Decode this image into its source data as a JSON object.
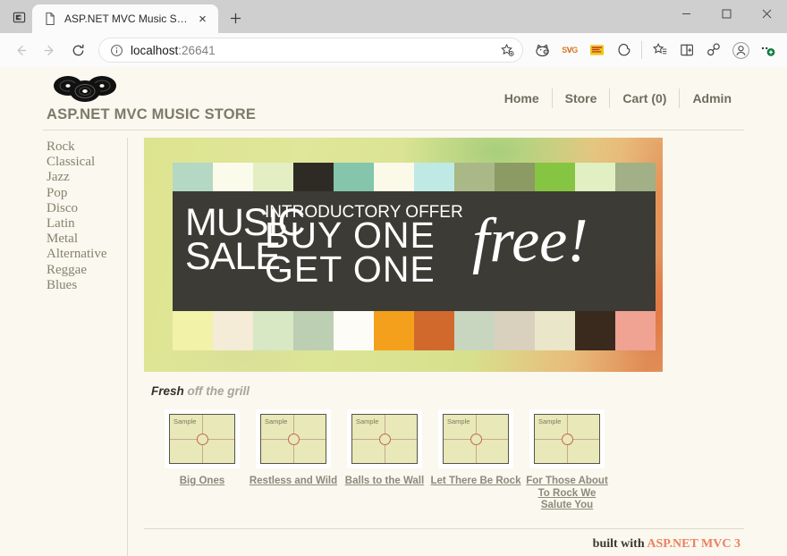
{
  "browser": {
    "tab": {
      "title": "ASP.NET MVC Music Store",
      "favicon": "page-icon",
      "close": "×"
    },
    "new_tab_label": "+",
    "tab_search_icon": "tab-search-icon",
    "window_controls": {
      "minimize": "−",
      "maximize": "□",
      "close": "✕"
    },
    "nav": {
      "back": "←",
      "forward": "→",
      "reload": "↻"
    },
    "omnibox": {
      "info_icon": "site-info-icon",
      "url_host": "localhost",
      "url_port": ":26641",
      "favorite_icon": "add-favorite-icon"
    },
    "extensions": [
      {
        "name": "extension-icon-pig",
        "glyph": "🐗"
      },
      {
        "name": "extension-icon-svg",
        "glyph": "SVG"
      },
      {
        "name": "extension-icon-yellow-badge",
        "glyph": "✉"
      },
      {
        "name": "extension-icon-puzzle-blob",
        "glyph": "⬟"
      }
    ],
    "actions": [
      {
        "name": "favorites-icon",
        "glyph": "☆"
      },
      {
        "name": "collections-icon",
        "glyph": "⊞"
      },
      {
        "name": "browser-essentials-icon",
        "glyph": "⚭"
      },
      {
        "name": "profile-icon",
        "glyph": "Ⓐ"
      },
      {
        "name": "settings-more-icon",
        "glyph": "⋯"
      }
    ]
  },
  "site": {
    "logo_name": "vinyl-records-logo",
    "title": "ASP.NET MVC MUSIC STORE",
    "nav": [
      {
        "label": "Home"
      },
      {
        "label": "Store"
      },
      {
        "label": "Cart (0)"
      },
      {
        "label": "Admin"
      }
    ]
  },
  "genres": [
    "Rock",
    "Classical",
    "Jazz",
    "Pop",
    "Disco",
    "Latin",
    "Metal",
    "Alternative",
    "Reggae",
    "Blues"
  ],
  "promo": {
    "music": "MUSIC",
    "sale": "SALE",
    "offer": "INTRODUCTORY OFFER",
    "buy_one": "BUY ONE",
    "get_one": "GET ONE",
    "free": "free!",
    "band_color": "#3d3b35",
    "swatches_top": [
      "#b4d8c3",
      "#fbfbeb",
      "#e4eec3",
      "#2e2b24",
      "#84c5ab",
      "#fbf9e8",
      "#bfe9e4",
      "#aab887",
      "#8b9b63",
      "#86c541",
      "#e0f0c2",
      "#a1b086"
    ],
    "swatches_bottom": [
      "#f2f2a8",
      "#f4ecd6",
      "#d8e7c4",
      "#bdcfb3",
      "#fdfcf6",
      "#f5a01d",
      "#d2692c",
      "#c8d6c0",
      "#d9d0bd",
      "#e9e6c9",
      "#3a2a1e",
      "#f0a293"
    ]
  },
  "fresh": {
    "bold": "Fresh",
    "rest": " off the grill"
  },
  "albums": [
    {
      "title": "Big Ones",
      "thumb_label": "Sample"
    },
    {
      "title": "Restless and Wild",
      "thumb_label": "Sample"
    },
    {
      "title": "Balls to the Wall",
      "thumb_label": "Sample"
    },
    {
      "title": "Let There Be Rock",
      "thumb_label": "Sample"
    },
    {
      "title": "For Those About To Rock We Salute You",
      "thumb_label": "Sample"
    }
  ],
  "footer": {
    "built_with": "built with ",
    "framework": "ASP.NET MVC 3"
  }
}
